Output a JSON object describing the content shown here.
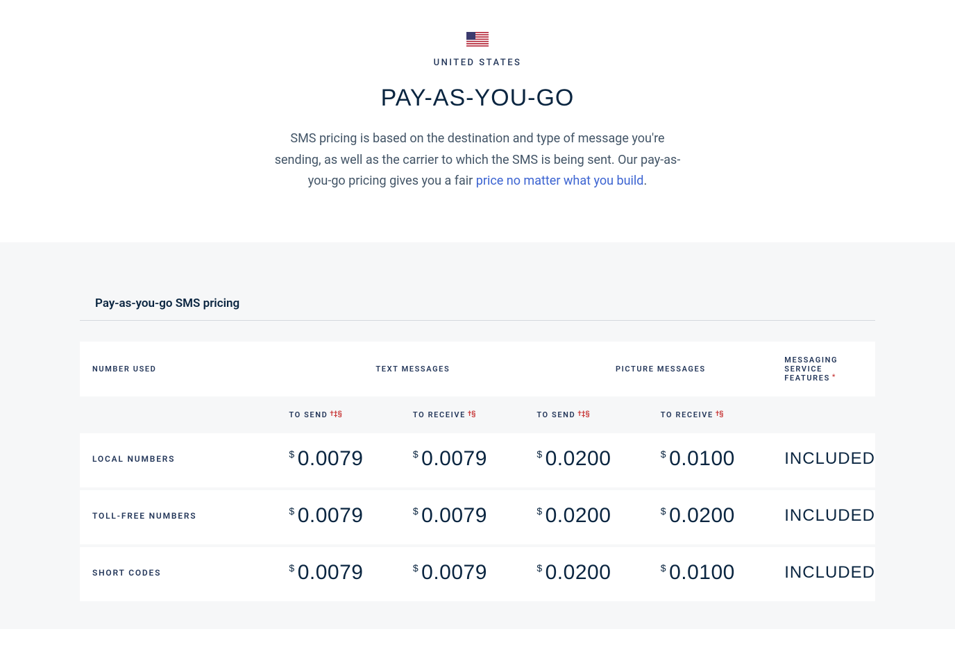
{
  "hero": {
    "country": "UNITED STATES",
    "title": "PAY-AS-YOU-GO",
    "text_before_link": "SMS pricing is based on the destination and type of message you're sending, as well as the carrier to which the SMS is being sent. Our pay-as-you-go pricing gives you a fair ",
    "link_text": "price no matter what you build",
    "text_after_link": "."
  },
  "tab": "Pay-as-you-go SMS pricing",
  "headers": {
    "number_used": "NUMBER USED",
    "text_messages": "TEXT MESSAGES",
    "picture_messages": "PICTURE MESSAGES",
    "messaging_features": "MESSAGING SERVICE FEATURES",
    "messaging_features_sup": "*",
    "to_send": "TO SEND",
    "to_send_sup": "†‡§",
    "to_receive": "TO RECEIVE",
    "to_receive_sup": "†§"
  },
  "currency": "$",
  "rows": [
    {
      "label": "LOCAL NUMBERS",
      "text_send": "0.0079",
      "text_receive": "0.0079",
      "pic_send": "0.0200",
      "pic_receive": "0.0100",
      "feature": "INCLUDED"
    },
    {
      "label": "TOLL-FREE NUMBERS",
      "text_send": "0.0079",
      "text_receive": "0.0079",
      "pic_send": "0.0200",
      "pic_receive": "0.0200",
      "feature": "INCLUDED"
    },
    {
      "label": "SHORT CODES",
      "text_send": "0.0079",
      "text_receive": "0.0079",
      "pic_send": "0.0200",
      "pic_receive": "0.0100",
      "feature": "INCLUDED"
    }
  ]
}
